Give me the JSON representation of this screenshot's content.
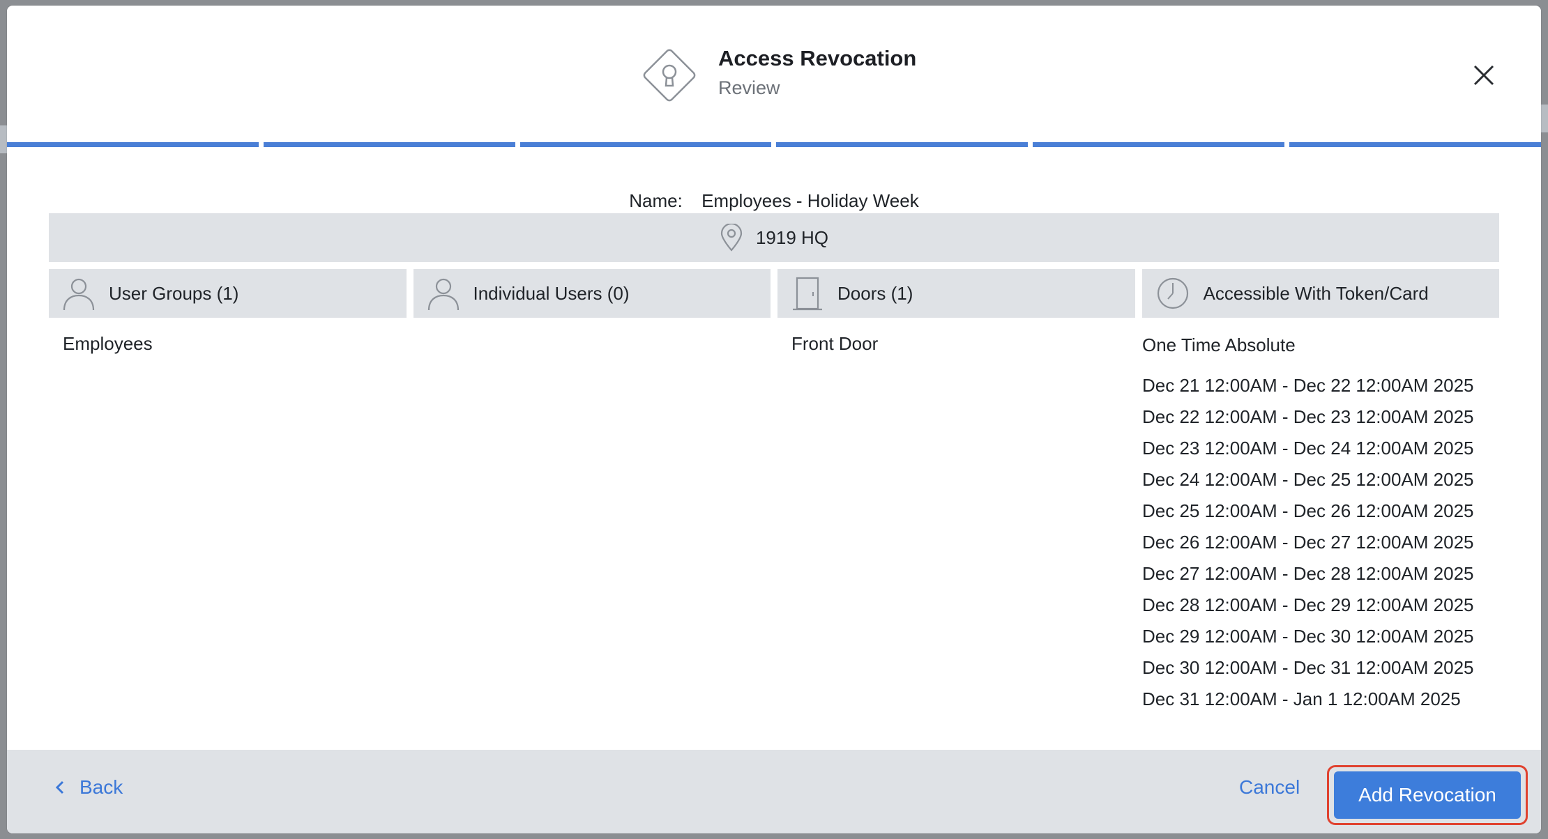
{
  "header": {
    "title": "Access Revocation",
    "subtitle": "Review",
    "logo_icon": "keyhole-diamond-icon",
    "close_icon": "close-icon"
  },
  "progress": {
    "steps_total": 6,
    "steps_complete": 6,
    "color": "#4a7fd6"
  },
  "name": {
    "label": "Name:",
    "value": "Employees - Holiday Week"
  },
  "site": {
    "icon": "location-pin-icon",
    "label": "1919 HQ"
  },
  "columns": {
    "user_groups": {
      "label": "User Groups (1)",
      "icon": "user-icon",
      "items": [
        "Employees"
      ]
    },
    "individual_users": {
      "label": "Individual Users (0)",
      "icon": "user-icon",
      "items": []
    },
    "doors": {
      "label": "Doors (1)",
      "icon": "door-icon",
      "items": [
        "Front Door"
      ]
    },
    "schedule": {
      "label": "Accessible With Token/Card",
      "icon": "clock-icon",
      "type": "One Time Absolute",
      "entries": [
        "Dec 21 12:00AM - Dec 22 12:00AM 2025",
        "Dec 22 12:00AM - Dec 23 12:00AM 2025",
        "Dec 23 12:00AM - Dec 24 12:00AM 2025",
        "Dec 24 12:00AM - Dec 25 12:00AM 2025",
        "Dec 25 12:00AM - Dec 26 12:00AM 2025",
        "Dec 26 12:00AM - Dec 27 12:00AM 2025",
        "Dec 27 12:00AM - Dec 28 12:00AM 2025",
        "Dec 28 12:00AM - Dec 29 12:00AM 2025",
        "Dec 29 12:00AM - Dec 30 12:00AM 2025",
        "Dec 30 12:00AM - Dec 31 12:00AM 2025",
        "Dec 31 12:00AM - Jan 1 12:00AM 2025"
      ]
    }
  },
  "footer": {
    "back_label": "Back",
    "cancel_label": "Cancel",
    "submit_label": "Add Revocation",
    "accent": "#3d7ddb",
    "highlight": "#e0422f"
  }
}
